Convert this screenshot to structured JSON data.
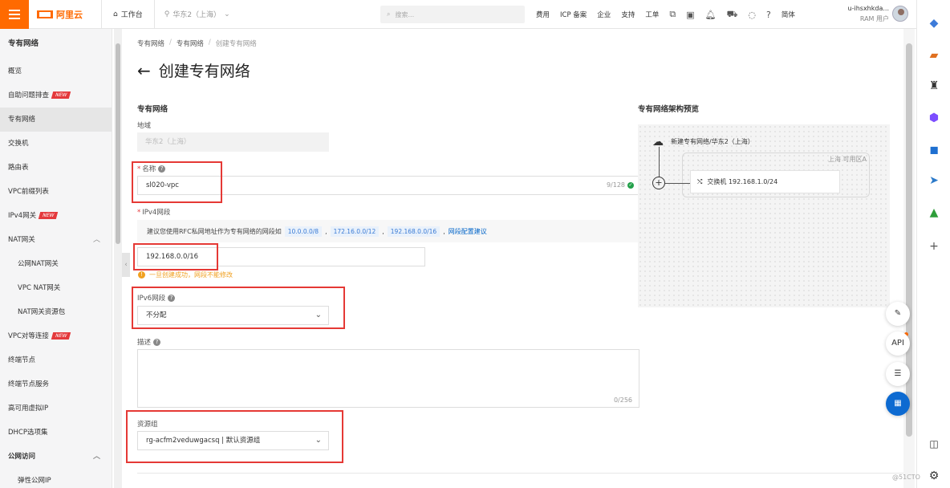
{
  "topbar": {
    "logo_text": "阿里云",
    "workbench": "工作台",
    "region": "华东2（上海）",
    "search_placeholder": "搜索...",
    "links": [
      "费用",
      "ICP 备案",
      "企业",
      "支持",
      "工单"
    ],
    "lang": "简体",
    "user_name": "u-ihsxhkda...",
    "user_role": "RAM 用户"
  },
  "sidebar": {
    "title": "专有网络",
    "items": [
      {
        "label": "概览"
      },
      {
        "label": "自助问题排查",
        "badge": "NEW"
      },
      {
        "label": "专有网络"
      },
      {
        "label": "交换机"
      },
      {
        "label": "路由表"
      },
      {
        "label": "VPC前缀列表"
      },
      {
        "label": "IPv4网关",
        "badge": "NEW"
      },
      {
        "label": "NAT网关"
      },
      {
        "label": "公网NAT网关"
      },
      {
        "label": "VPC NAT网关"
      },
      {
        "label": "NAT网关资源包"
      },
      {
        "label": "VPC对等连接",
        "badge": "NEW"
      },
      {
        "label": "终端节点"
      },
      {
        "label": "终端节点服务"
      },
      {
        "label": "高可用虚拟IP"
      },
      {
        "label": "DHCP选项集"
      },
      {
        "label": "公网访问"
      },
      {
        "label": "弹性公网IP"
      }
    ]
  },
  "breadcrumb": [
    "专有网络",
    "专有网络",
    "创建专有网络"
  ],
  "page_title": "创建专有网络",
  "form": {
    "section_title": "专有网络",
    "region_label": "地域",
    "region_value": "华东2（上海）",
    "name_label": "名称",
    "name_value": "sl020-vpc",
    "name_counter": "9/128",
    "ipv4_label": "IPv4网段",
    "hint_text": "建议您使用RFC私网地址作为专有网络的网段如",
    "hint_tags": [
      "10.0.0.0/8",
      "172.16.0.0/12",
      "192.168.0.0/16"
    ],
    "hint_link": "网段配置建议",
    "ipv4_value": "192.168.0.0/16",
    "ipv4_warning": "一旦创建成功，网段不能修改",
    "ipv6_label": "IPv6网段",
    "ipv6_value": "不分配",
    "desc_label": "描述",
    "desc_counter": "0/256",
    "rg_label": "资源组",
    "rg_value": "rg-acfm2veduwgacsq | 默认资源组"
  },
  "preview": {
    "title": "专有网络架构预览",
    "vpc_label": "新建专有网络/华东2（上海）",
    "zone_label": "上海 可用区A",
    "switch_label": "交换机 192.168.1.0/24"
  },
  "floating": {
    "api_label": "API"
  },
  "watermark": "@51CTO"
}
